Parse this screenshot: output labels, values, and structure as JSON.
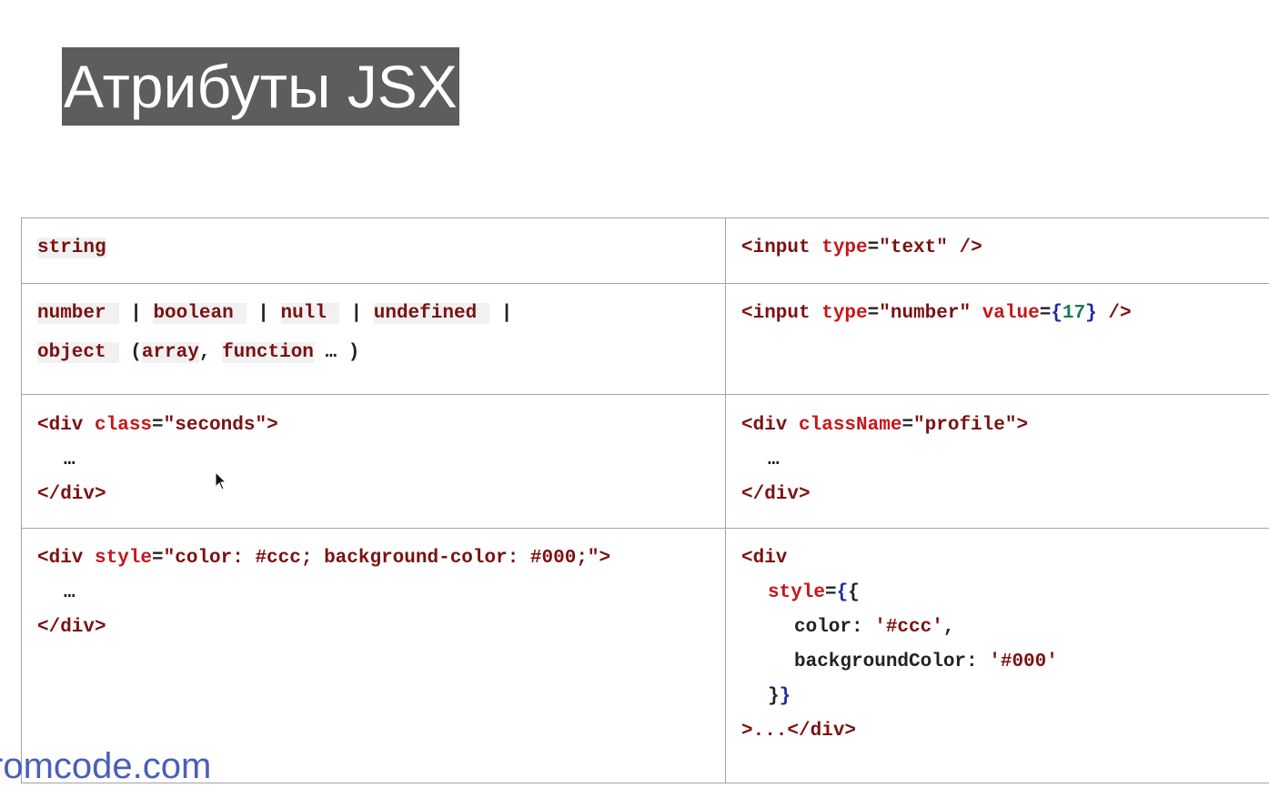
{
  "title": "Атрибуты JSX",
  "watermark": "romcode.com",
  "rows": {
    "r1": {
      "left": {
        "type": "string"
      },
      "right": {
        "open": "<input ",
        "attr": "type",
        "eq": "=",
        "val": "\"text\"",
        "close": " />"
      }
    },
    "r2": {
      "left": {
        "t1": "number",
        "sep": "|",
        "t2": "boolean",
        "t3": "null",
        "t4": "undefined",
        "t5": "object",
        "paren_open": "(",
        "t6": "array",
        "comma": ",",
        "t7": "function",
        "ellipsis": "…",
        "paren_close": ")"
      },
      "right": {
        "open": "<input ",
        "attr1": "type",
        "eq": "=",
        "val1": "\"number\"",
        "attr2": "value",
        "brace_open": "{",
        "num": "17",
        "brace_close": "}",
        "close": " />"
      }
    },
    "r3": {
      "left": {
        "open": "<div ",
        "attr": "class",
        "eq": "=",
        "val": "\"seconds\"",
        "gt": ">",
        "ellipsis": "…",
        "close_tag": "</div>"
      },
      "right": {
        "open": "<div ",
        "attr": "className",
        "eq": "=",
        "val": "\"profile\"",
        "gt": ">",
        "ellipsis": "…",
        "close_tag": "</div>"
      }
    },
    "r4": {
      "left": {
        "open": "<div ",
        "attr": "style",
        "eq": "=",
        "val": "\"color: #ccc; background-color: #000;\"",
        "gt": ">",
        "ellipsis": "…",
        "close_tag": "</div>"
      },
      "right": {
        "open": "<div",
        "attr": "style",
        "eq": "=",
        "brace_open": "{",
        "obj_open": "{",
        "key1": "color: ",
        "val1": "'#ccc'",
        "comma": ",",
        "key2": "backgroundColor: ",
        "val2": "'#000'",
        "obj_close": "}",
        "brace_close": "}",
        "tail": ">...</div>"
      }
    }
  },
  "colors": {
    "title_bg": "#5d5d5d",
    "tag": "#7b1111",
    "attr": "#c8151a",
    "number": "#1b7a5a",
    "brace": "#1a2aa0",
    "watermark": "#4a5fb8"
  }
}
